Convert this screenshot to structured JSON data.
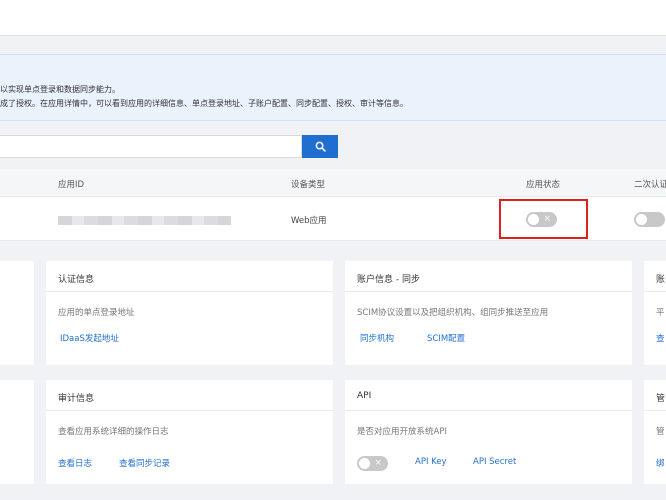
{
  "notice": {
    "line1": "以实现单点登录和数据同步能力。",
    "line2": "成了授权。在应用详情中，可以看到应用的详细信息、单点登录地址、子账户配置、同步配置、授权、审计等信息。"
  },
  "search": {
    "placeholder": "",
    "button_icon": "search-icon"
  },
  "table": {
    "columns": [
      "应用ID",
      "设备类型",
      "应用状态",
      "二次认证"
    ],
    "row": {
      "device_type": "Web应用"
    }
  },
  "cards": {
    "auth": {
      "title": "认证信息",
      "desc": "应用的单点登录地址",
      "link": "IDaaS发起地址"
    },
    "account": {
      "title": "账户信息 - 同步",
      "desc": "SCIM协议设置以及把组织机构、组同步推送至应用",
      "link1": "同步机构",
      "link2": "SCIM配置"
    },
    "right_top": {
      "title": "账",
      "desc": "平",
      "link": "查"
    },
    "audit": {
      "title": "审计信息",
      "desc": "查看应用系统详细的操作日志",
      "link1": "查看日志",
      "link2": "查看同步记录"
    },
    "api": {
      "title": "API",
      "desc": "是否对应用开放系统API",
      "link1": "API Key",
      "link2": "API Secret"
    },
    "right_bottom": {
      "title": "管",
      "desc": "管",
      "link": "绑"
    }
  },
  "colors": {
    "primary": "#1f6fd1",
    "highlight": "#e02020",
    "toggle_off": "#c8c8c8"
  }
}
